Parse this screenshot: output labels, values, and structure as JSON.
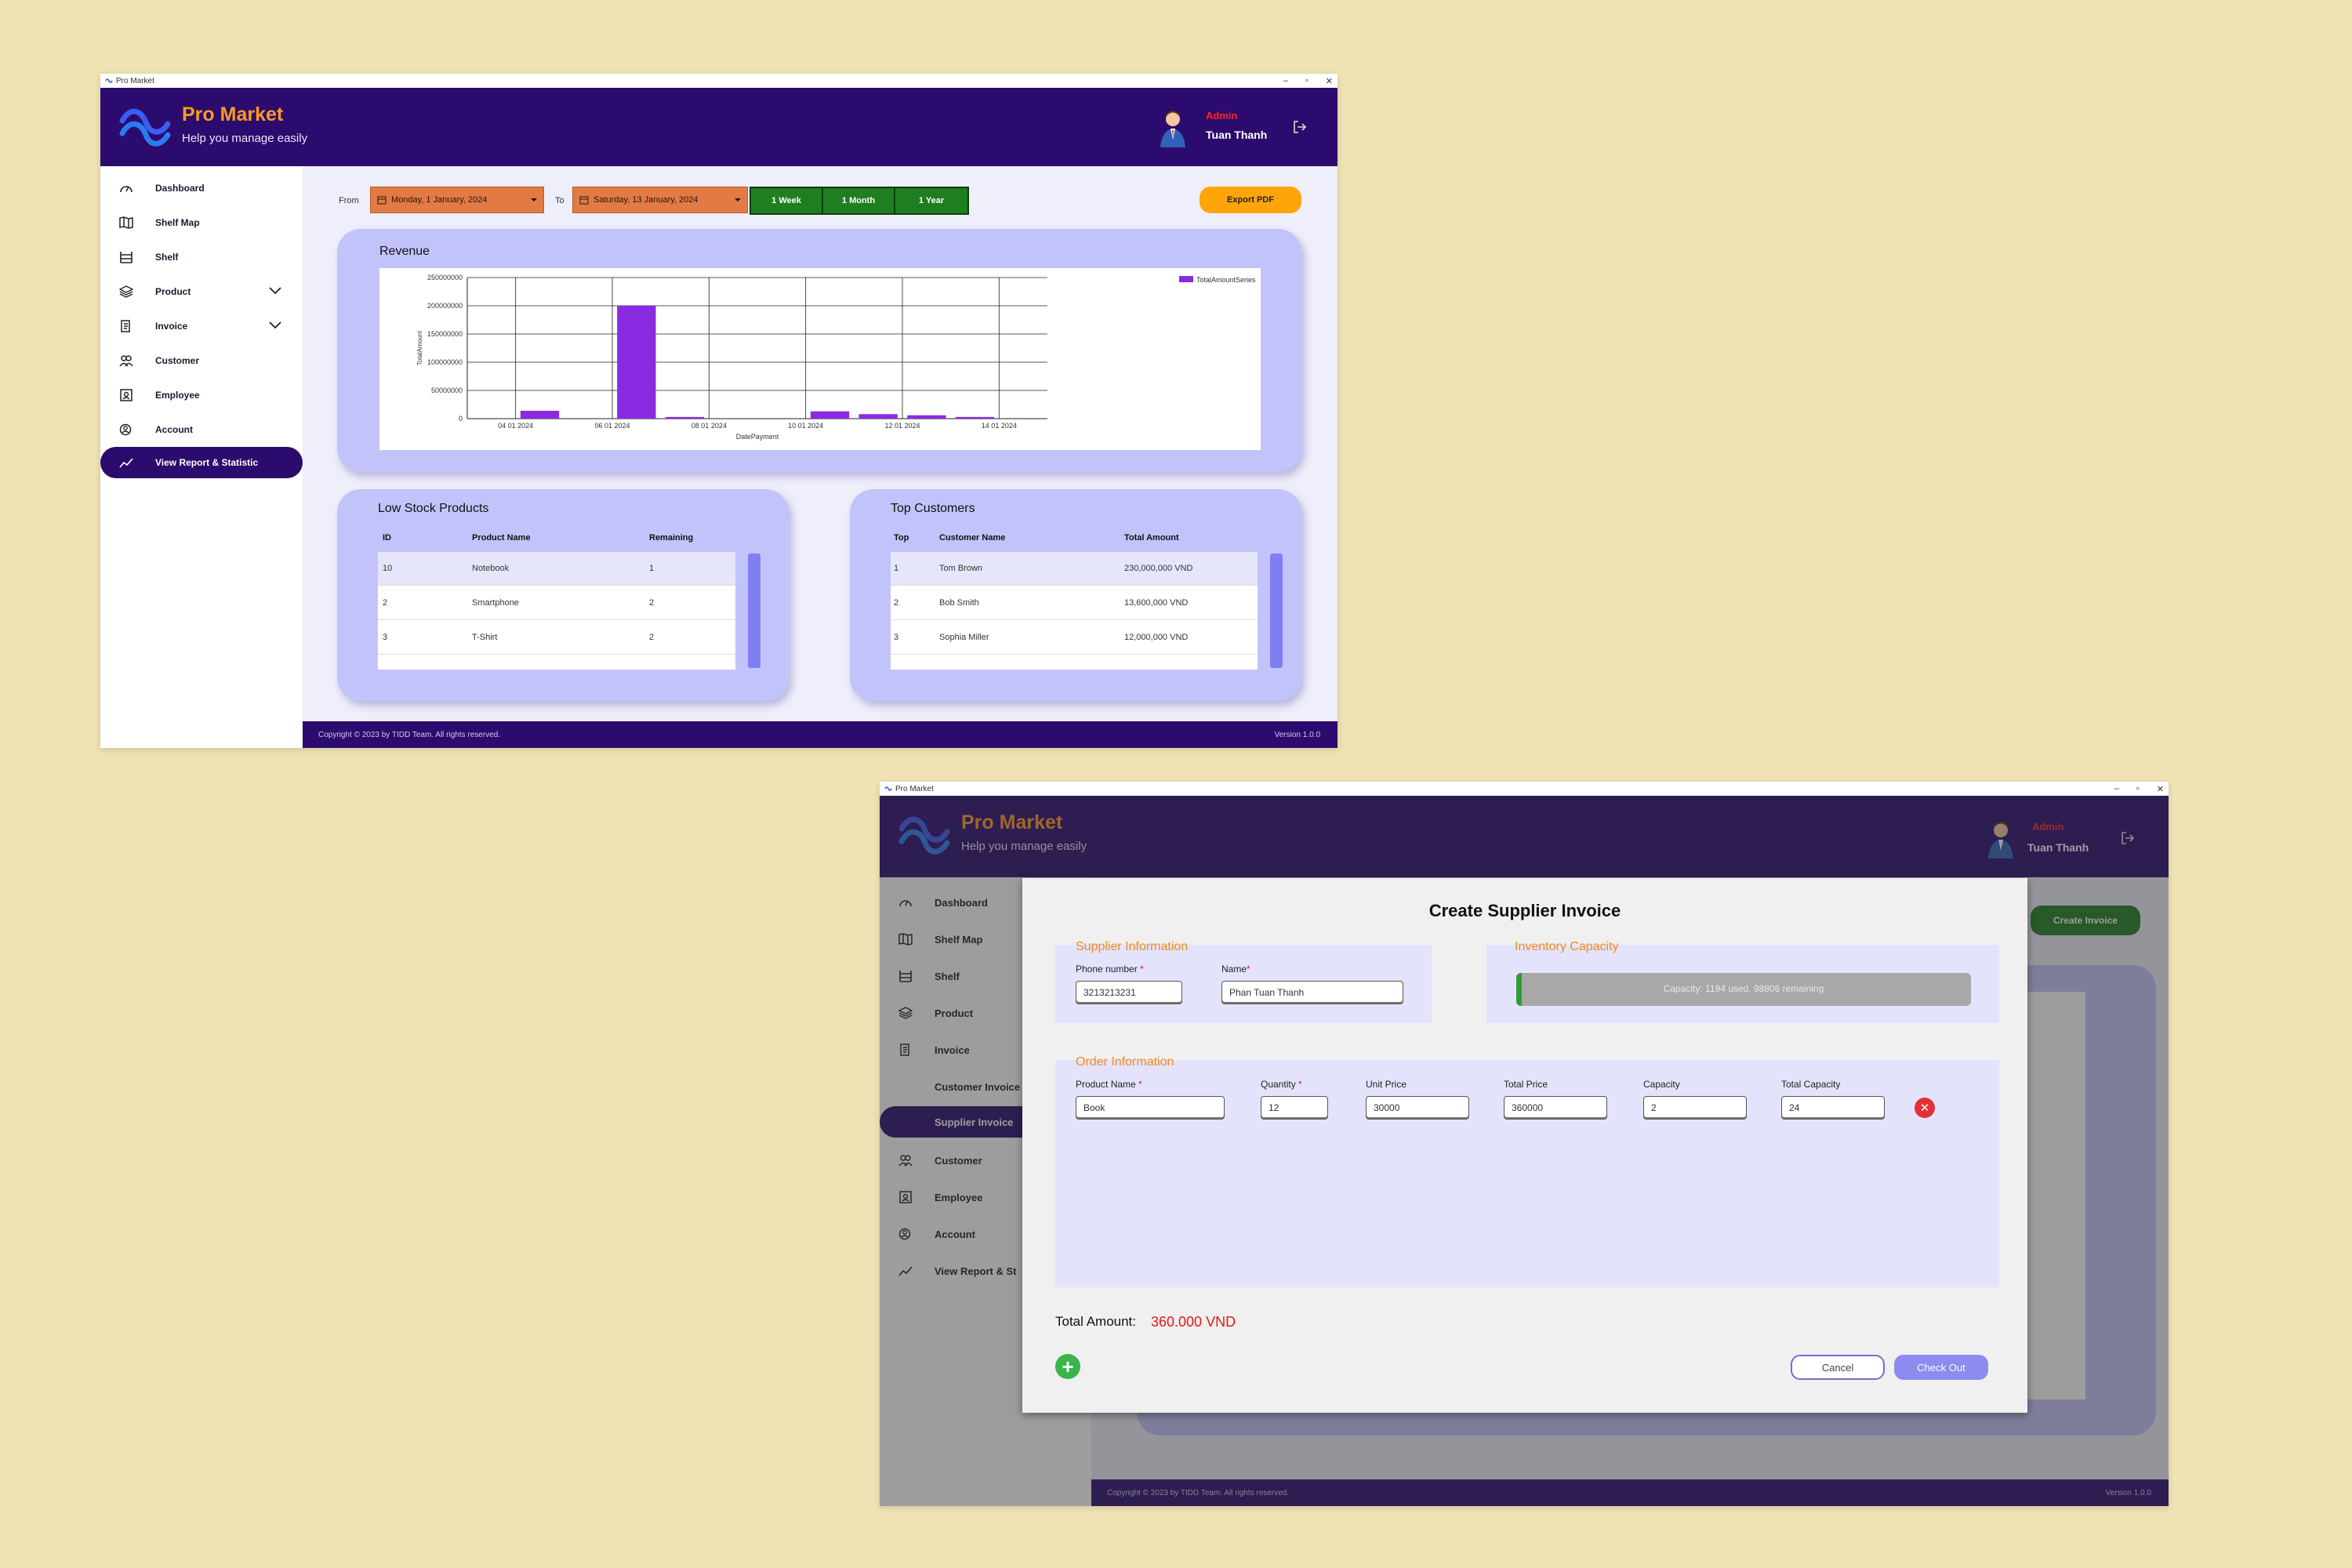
{
  "window1": {
    "window_title": "Pro Market",
    "brand": {
      "name": "Pro Market",
      "tagline": "Help you manage easily"
    },
    "user": {
      "role": "Admin",
      "name": "Tuan Thanh"
    },
    "sidebar": {
      "items": [
        {
          "label": "Dashboard",
          "icon": "dashboard-icon"
        },
        {
          "label": "Shelf Map",
          "icon": "map-icon"
        },
        {
          "label": "Shelf",
          "icon": "shelf-icon"
        },
        {
          "label": "Product",
          "icon": "product-icon"
        },
        {
          "label": "Invoice",
          "icon": "invoice-icon"
        },
        {
          "label": "Customer",
          "icon": "customer-icon"
        },
        {
          "label": "Employee",
          "icon": "employee-icon"
        },
        {
          "label": "Account",
          "icon": "account-icon"
        },
        {
          "label": "View Report & Statistic",
          "icon": "chart-icon"
        }
      ]
    },
    "filters": {
      "from_label": "From",
      "from_date": "Monday, 1 January, 2024",
      "to_label": "To",
      "to_date": "Saturday, 13 January, 2024",
      "ranges": [
        "1 Week",
        "1 Month",
        "1 Year"
      ],
      "export_label": "Export PDF"
    },
    "revenue": {
      "title": "Revenue"
    },
    "low_stock": {
      "title": "Low Stock Products",
      "columns": [
        "ID",
        "Product Name",
        "Remaining"
      ],
      "rows": [
        [
          "10",
          "Notebook",
          "1"
        ],
        [
          "2",
          "Smartphone",
          "2"
        ],
        [
          "3",
          "T-Shirt",
          "2"
        ]
      ]
    },
    "top_customers": {
      "title": "Top Customers",
      "columns": [
        "Top",
        "Customer Name",
        "Total Amount"
      ],
      "rows": [
        [
          "1",
          "Tom Brown",
          "230,000,000 VND"
        ],
        [
          "2",
          "Bob Smith",
          "13,600,000 VND"
        ],
        [
          "3",
          "Sophia Miller",
          "12,000,000 VND"
        ]
      ]
    },
    "footer": {
      "copyright": "Copyright © 2023 by TIDD Team. All rights reserved.",
      "version": "Version 1.0.0"
    }
  },
  "chart_data": {
    "type": "bar",
    "title": "",
    "xlabel": "DatePayment",
    "ylabel": "TotalAmount",
    "x_ticks": [
      "04 01 2024",
      "06 01 2024",
      "08 01 2024",
      "10 01 2024",
      "12 01 2024",
      "14 01 2024"
    ],
    "y_ticks": [
      "0",
      "50000000",
      "100000000",
      "150000000",
      "200000000",
      "250000000"
    ],
    "ylim": [
      0,
      250000000
    ],
    "grid": true,
    "legend_position": "top-right",
    "series": [
      {
        "name": "TotalAmountSeries",
        "color": "#8a2be2",
        "x": [
          "05 01 2024",
          "07 01 2024",
          "08 01 2024",
          "11 01 2024",
          "12 01 2024",
          "13 01 2024",
          "14 01 2024"
        ],
        "values": [
          14000000,
          200000000,
          3000000,
          13000000,
          8000000,
          6000000,
          3000000
        ]
      }
    ]
  },
  "window2": {
    "window_title": "Pro Market",
    "brand": {
      "name": "Pro Market",
      "tagline": "Help you manage easily"
    },
    "user": {
      "role": "Admin",
      "name": "Tuan Thanh"
    },
    "sidebar": {
      "items": [
        {
          "label": "Dashboard",
          "icon": "dashboard-icon"
        },
        {
          "label": "Shelf Map",
          "icon": "map-icon"
        },
        {
          "label": "Shelf",
          "icon": "shelf-icon"
        },
        {
          "label": "Product",
          "icon": "product-icon"
        },
        {
          "label": "Invoice",
          "icon": "invoice-icon"
        },
        {
          "label": "Customer Invoice",
          "icon": ""
        },
        {
          "label": "Supplier Invoice",
          "icon": ""
        },
        {
          "label": "Customer",
          "icon": "customer-icon"
        },
        {
          "label": "Employee",
          "icon": "employee-icon"
        },
        {
          "label": "Account",
          "icon": "account-icon"
        },
        {
          "label": "View Report & St",
          "icon": "chart-icon"
        }
      ]
    },
    "create_invoice_label": "Create Invoice",
    "footer": {
      "copyright": "Copyright © 2023 by TIDD Team. All rights reserved.",
      "version": "Version 1.0.0"
    },
    "modal": {
      "title": "Create Supplier Invoice",
      "supplier": {
        "title": "Supplier Information",
        "phone_label": "Phone number",
        "phone_value": "3213213231",
        "name_label": "Name",
        "name_value": "Phan Tuan Thanh"
      },
      "inventory": {
        "title": "Inventory Capacity",
        "text": "Capacity: 1194 used, 98806 remaining",
        "fill_fraction": 0.012
      },
      "order": {
        "title": "Order Information",
        "labels": {
          "product_name": "Product Name",
          "quantity": "Quantity",
          "unit_price": "Unit Price",
          "total_price": "Total Price",
          "capacity": "Capacity",
          "total_capacity": "Total Capacity"
        },
        "row": {
          "product_name": "Book",
          "quantity": "12",
          "unit_price": "30000",
          "total_price": "360000",
          "capacity": "2",
          "total_capacity": "24"
        }
      },
      "total_label": "Total Amount:",
      "total_value": "360.000 VND",
      "cancel_label": "Cancel",
      "checkout_label": "Check Out"
    }
  }
}
